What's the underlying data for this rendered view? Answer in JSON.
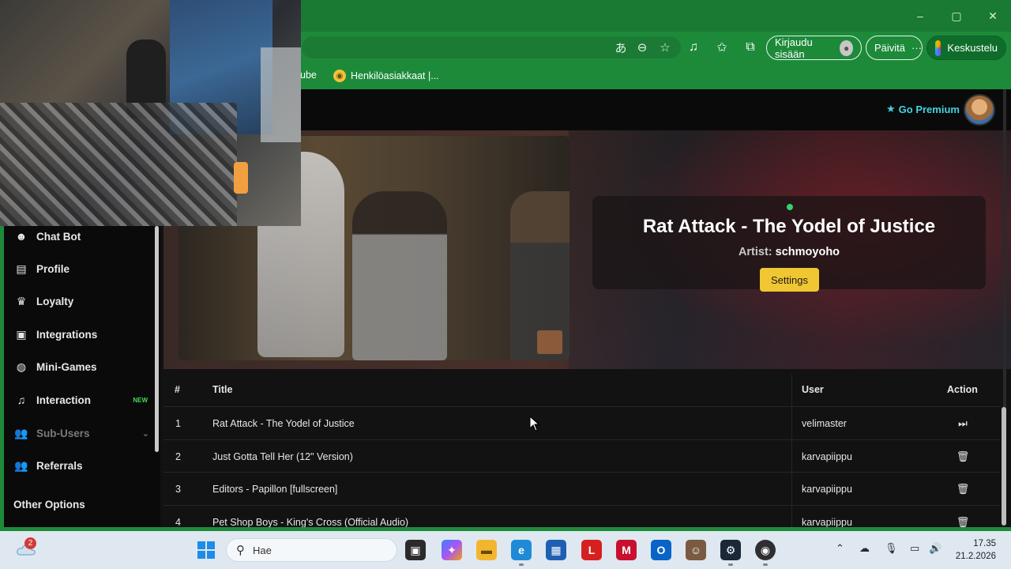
{
  "browser": {
    "window_controls": [
      "–",
      "▢",
      "✕"
    ],
    "account_button": "Kirjaudu sisään",
    "update_button": "Päivitä",
    "copilot_button": "Keskustelu",
    "bookmarks": [
      {
        "label": "ube"
      },
      {
        "label": "Henkilöasiakkaat |..."
      }
    ]
  },
  "header": {
    "premium_label": "Go Premium"
  },
  "now_playing": {
    "title": "Rat Attack - The Yodel of Justice",
    "artist_label": "Artist:",
    "artist": "schmoyoho",
    "settings_button": "Settings"
  },
  "sidebar": {
    "items": [
      {
        "label": "Chat Bot",
        "icon": "robot-icon",
        "glyph": "☻"
      },
      {
        "label": "Profile",
        "icon": "id-card-icon",
        "glyph": "▤"
      },
      {
        "label": "Loyalty",
        "icon": "trophy-icon",
        "glyph": "♛"
      },
      {
        "label": "Integrations",
        "icon": "plug-icon",
        "glyph": "▣"
      },
      {
        "label": "Mini-Games",
        "icon": "gamepad-icon",
        "glyph": "◍"
      },
      {
        "label": "Interaction",
        "icon": "music-note-icon",
        "glyph": "♫",
        "badge": "NEW"
      },
      {
        "label": "Sub-Users",
        "icon": "users-icon",
        "glyph": "👥"
      },
      {
        "label": "Referrals",
        "icon": "user-group-icon",
        "glyph": "👥"
      }
    ],
    "other_options": "Other Options"
  },
  "queue": {
    "headers": {
      "num": "#",
      "title": "Title",
      "user": "User",
      "action": "Action"
    },
    "rows": [
      {
        "num": "1",
        "title": "Rat Attack - The Yodel of Justice",
        "user": "velimaster",
        "action": "⏭"
      },
      {
        "num": "2",
        "title": "Just Gotta Tell Her (12\" Version)",
        "user": "karvapiippu",
        "action": "🗑"
      },
      {
        "num": "3",
        "title": "Editors - Papillon [fullscreen]",
        "user": "karvapiippu",
        "action": "🗑"
      },
      {
        "num": "4",
        "title": "Pet Shop Boys - King's Cross (Official Audio)",
        "user": "karvapiippu",
        "action": "🗑"
      }
    ]
  },
  "taskbar": {
    "notification_count": "2",
    "search_placeholder": "Hae",
    "time": "17.35",
    "date": "21.2.2026"
  },
  "colors": {
    "browser_green": "#1d8a3a",
    "accent_yellow": "#f0c632",
    "premium_cyan": "#45d2e0",
    "new_badge": "#3ddc5a"
  }
}
